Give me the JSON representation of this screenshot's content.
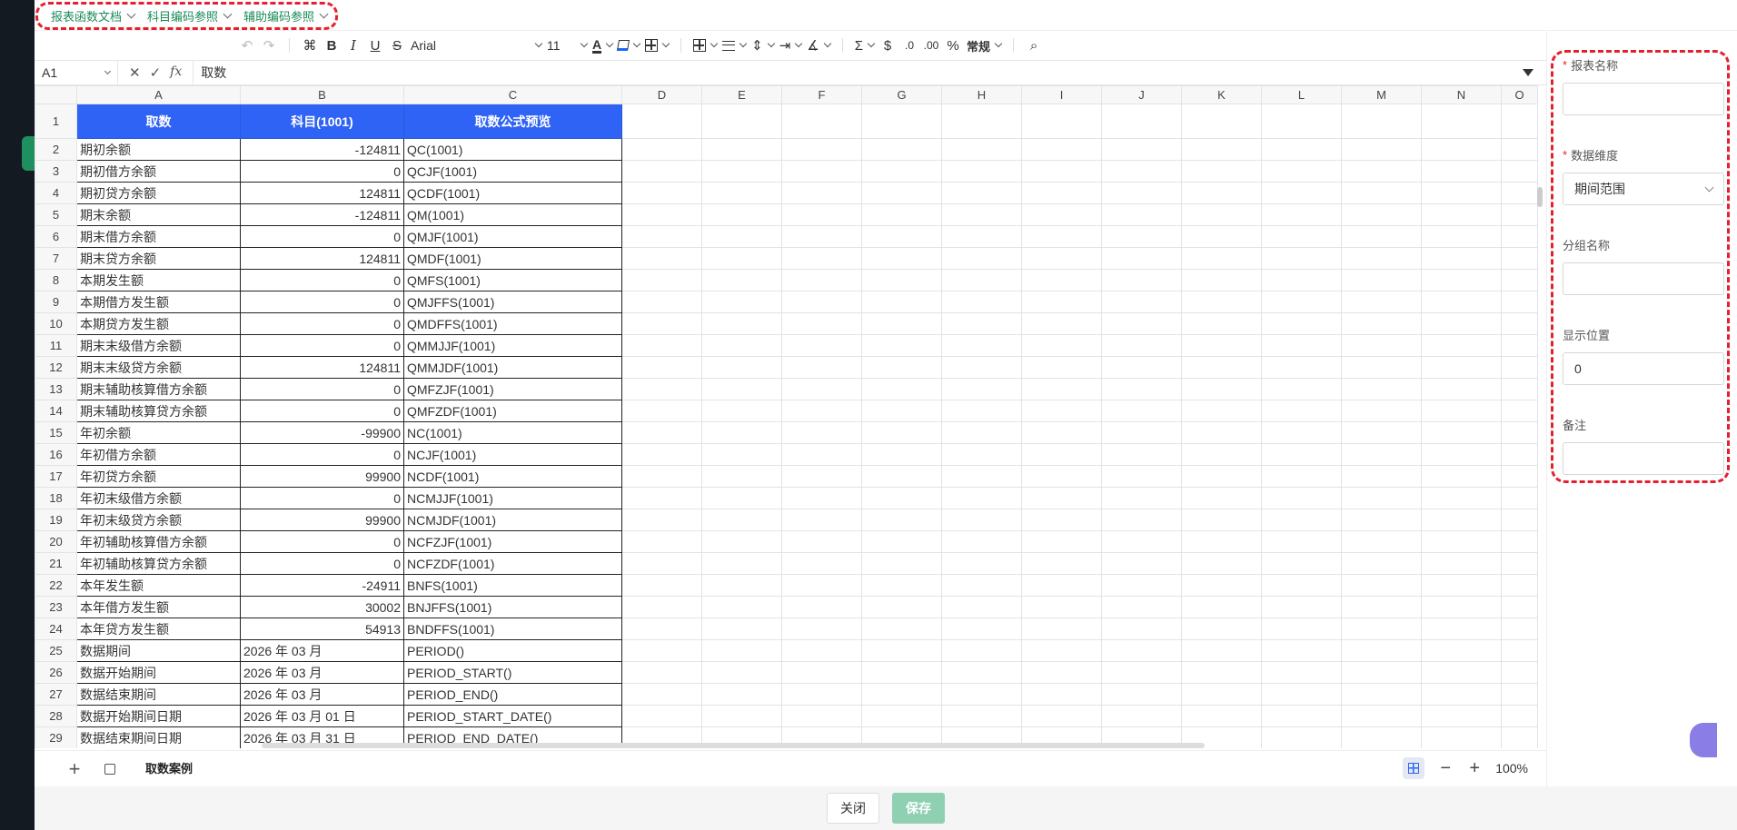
{
  "refs": [
    {
      "label": "报表函数文档"
    },
    {
      "label": "科目编码参照"
    },
    {
      "label": "辅助编码参照"
    }
  ],
  "toolbar": {
    "font": "Arial",
    "size": "11",
    "number_format": "常规"
  },
  "formula_bar": {
    "cell_ref": "A1",
    "content": "取数"
  },
  "columns": [
    "A",
    "B",
    "C",
    "D",
    "E",
    "F",
    "G",
    "H",
    "I",
    "J",
    "K",
    "L",
    "M",
    "N",
    "O"
  ],
  "header_row": {
    "a": "取数",
    "b": "科目(1001)",
    "c": "取数公式预览"
  },
  "rows": [
    {
      "n": "2",
      "a": "期初余额",
      "b": "-124811",
      "c": "QC(1001)",
      "num": true
    },
    {
      "n": "3",
      "a": "期初借方余额",
      "b": "0",
      "c": "QCJF(1001)",
      "num": true
    },
    {
      "n": "4",
      "a": "期初贷方余额",
      "b": "124811",
      "c": "QCDF(1001)",
      "num": true
    },
    {
      "n": "5",
      "a": "期末余额",
      "b": "-124811",
      "c": "QM(1001)",
      "num": true
    },
    {
      "n": "6",
      "a": "期末借方余额",
      "b": "0",
      "c": "QMJF(1001)",
      "num": true
    },
    {
      "n": "7",
      "a": "期末贷方余额",
      "b": "124811",
      "c": "QMDF(1001)",
      "num": true
    },
    {
      "n": "8",
      "a": "本期发生额",
      "b": "0",
      "c": "QMFS(1001)",
      "num": true
    },
    {
      "n": "9",
      "a": "本期借方发生额",
      "b": "0",
      "c": "QMJFFS(1001)",
      "num": true
    },
    {
      "n": "10",
      "a": "本期贷方发生额",
      "b": "0",
      "c": "QMDFFS(1001)",
      "num": true
    },
    {
      "n": "11",
      "a": "期末末级借方余额",
      "b": "0",
      "c": "QMMJJF(1001)",
      "num": true
    },
    {
      "n": "12",
      "a": "期末末级贷方余额",
      "b": "124811",
      "c": "QMMJDF(1001)",
      "num": true
    },
    {
      "n": "13",
      "a": "期末辅助核算借方余额",
      "b": "0",
      "c": "QMFZJF(1001)",
      "num": true
    },
    {
      "n": "14",
      "a": "期末辅助核算贷方余额",
      "b": "0",
      "c": "QMFZDF(1001)",
      "num": true
    },
    {
      "n": "15",
      "a": "年初余额",
      "b": "-99900",
      "c": "NC(1001)",
      "num": true
    },
    {
      "n": "16",
      "a": "年初借方余额",
      "b": "0",
      "c": "NCJF(1001)",
      "num": true
    },
    {
      "n": "17",
      "a": "年初贷方余额",
      "b": "99900",
      "c": "NCDF(1001)",
      "num": true
    },
    {
      "n": "18",
      "a": "年初末级借方余额",
      "b": "0",
      "c": "NCMJJF(1001)",
      "num": true
    },
    {
      "n": "19",
      "a": "年初末级贷方余额",
      "b": "99900",
      "c": "NCMJDF(1001)",
      "num": true
    },
    {
      "n": "20",
      "a": "年初辅助核算借方余额",
      "b": "0",
      "c": "NCFZJF(1001)",
      "num": true
    },
    {
      "n": "21",
      "a": "年初辅助核算贷方余额",
      "b": "0",
      "c": "NCFZDF(1001)",
      "num": true
    },
    {
      "n": "22",
      "a": "本年发生额",
      "b": "-24911",
      "c": "BNFS(1001)",
      "num": true
    },
    {
      "n": "23",
      "a": "本年借方发生额",
      "b": "30002",
      "c": "BNJFFS(1001)",
      "num": true
    },
    {
      "n": "24",
      "a": "本年贷方发生额",
      "b": "54913",
      "c": "BNDFFS(1001)",
      "num": true
    },
    {
      "n": "25",
      "a": "数据期间",
      "b": "2026 年 03 月",
      "c": "PERIOD()",
      "num": false
    },
    {
      "n": "26",
      "a": "数据开始期间",
      "b": "2026 年 03 月",
      "c": "PERIOD_START()",
      "num": false
    },
    {
      "n": "27",
      "a": "数据结束期间",
      "b": "2026 年 03 月",
      "c": "PERIOD_END()",
      "num": false
    },
    {
      "n": "28",
      "a": "数据开始期间日期",
      "b": "2026 年 03 月 01 日",
      "c": "PERIOD_START_DATE()",
      "num": false
    },
    {
      "n": "29",
      "a": "数据结束期间日期",
      "b": "2026 年 03 月 31 日",
      "c": "PERIOD_END_DATE()",
      "num": false
    }
  ],
  "sheet_bar": {
    "tab": "取数案例",
    "zoom": "100%"
  },
  "footer": {
    "close_label": "关闭",
    "save_label": "保存"
  },
  "form": {
    "report_name": {
      "label": "报表名称",
      "value": ""
    },
    "dimension": {
      "label": "数据维度",
      "value": "期间范围"
    },
    "group_name": {
      "label": "分组名称",
      "value": ""
    },
    "position": {
      "label": "显示位置",
      "value": "0"
    },
    "remark": {
      "label": "备注",
      "value": ""
    }
  },
  "colors": {
    "accent": "#1c8a5c",
    "header_blue": "#2f63f5",
    "highlight_red": "#e5202e",
    "save_button": "#8fd0b2"
  }
}
